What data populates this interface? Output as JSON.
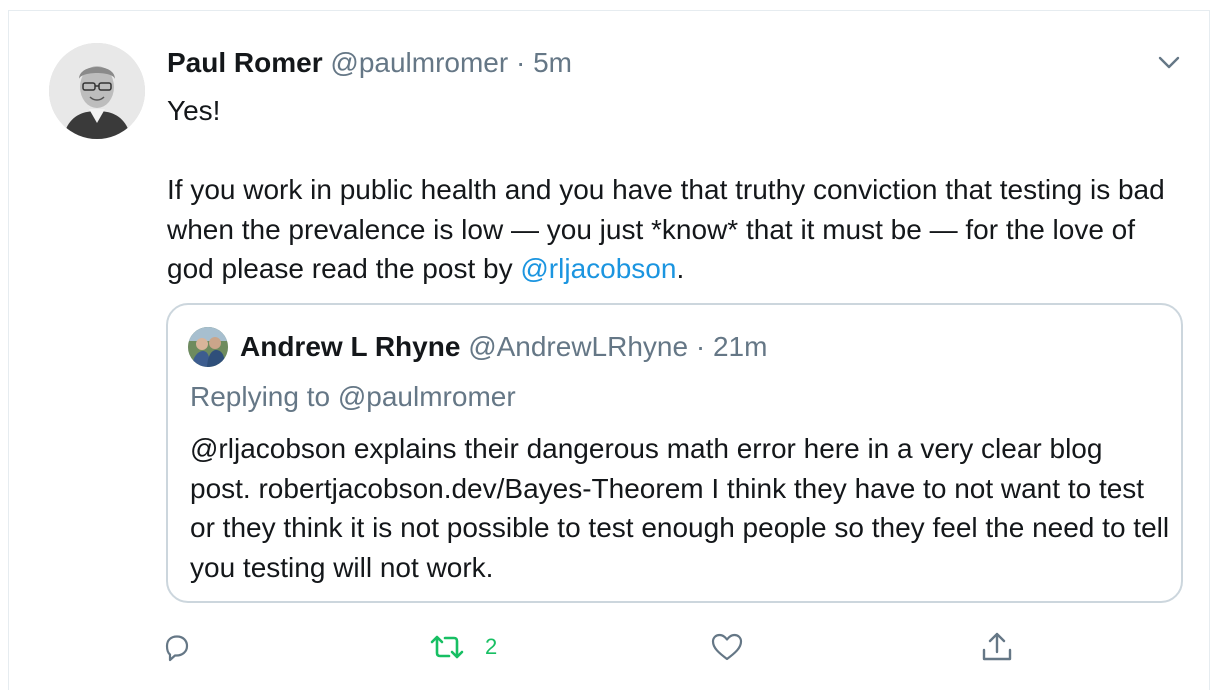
{
  "tweet": {
    "author_name": "Paul Romer",
    "handle": "@paulmromer",
    "separator": " · ",
    "time": "5m",
    "line1": "Yes!",
    "para_before_link": "If you work in public health and you have that truthy conviction that testing is bad when the prevalence is low — you just *know* that it must be — for the love of god please read the post by ",
    "mention": "@rljacobson",
    "para_after_link": "."
  },
  "quoted_tweet": {
    "author_name": "Andrew L Rhyne",
    "handle": "@AndrewLRhyne",
    "separator": " · ",
    "time": "21m",
    "replying_to": "Replying to @paulmromer",
    "text": "@rljacobson explains their dangerous math error here in a very clear blog post. robertjacobson.dev/Bayes-Theorem  I think they have to not want to test or they think it is not possible to test enough people so they feel the need to tell you testing will not work."
  },
  "actions": {
    "retweet_count": "2"
  },
  "colors": {
    "link": "#1b95e0",
    "muted": "#657786",
    "retweet_green": "#17bf63",
    "border": "#ccd6dd"
  },
  "icons": [
    "chevron-down-icon",
    "reply-icon",
    "retweet-icon",
    "like-icon",
    "share-icon"
  ]
}
